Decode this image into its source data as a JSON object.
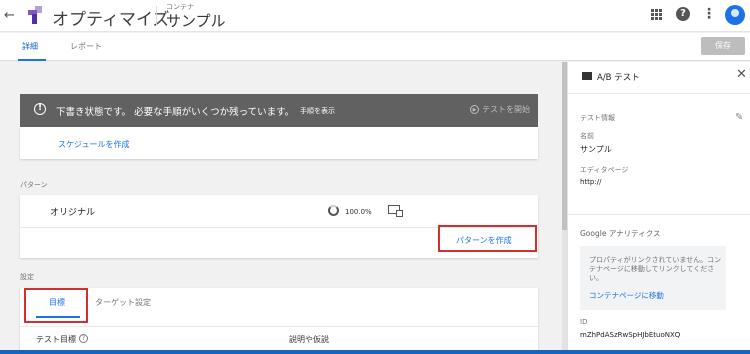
{
  "header": {
    "back_icon": "arrow-left-icon",
    "app_name": "オプティマイズ",
    "context_label": "コンテナ",
    "context_name": "サンプル",
    "apps_icon": "apps-grid-icon",
    "help_icon": "help-icon",
    "more_icon": "more-vert-icon"
  },
  "tabs": [
    {
      "label": "詳細"
    },
    {
      "label": "レポート"
    }
  ],
  "toolbar": {
    "save_label": "保存"
  },
  "banner": {
    "icon": "!",
    "text": "下書き状態です。 必要な手順がいくつか残っています。",
    "link": "手順を表示",
    "start_label": "テストを開始"
  },
  "schedule": {
    "link": "スケジュールを作成"
  },
  "patterns": {
    "section_label": "パターン",
    "original": "オリジナル",
    "percent": "100.0%",
    "create_link": "パターンを作成"
  },
  "settings": {
    "section_label": "設定",
    "tabs": [
      {
        "label": "目標"
      },
      {
        "label": "ターゲット設定"
      }
    ],
    "test_goal_label": "テスト目標",
    "help_glyph": "?",
    "description_label": "説明や仮説"
  },
  "panel": {
    "title": "A/B テスト",
    "close_glyph": "✕",
    "test_info_label": "テスト情報",
    "name_label": "名前",
    "name_value": "サンプル",
    "editor_page_label": "エディタページ",
    "editor_page_value": "http://",
    "analytics_label": "Google アナリティクス",
    "analytics_info": "プロパティがリンクされていません。コンテナページに移動してリンクしてください。",
    "analytics_link": "コンテナページに移動",
    "id_label": "ID",
    "id_value": "mZhPdASzRwSpHJbEtuoNXQ"
  },
  "colors": {
    "accent": "#1a73e8",
    "banner_bg": "#616161",
    "highlight_red": "#d32f2f"
  }
}
